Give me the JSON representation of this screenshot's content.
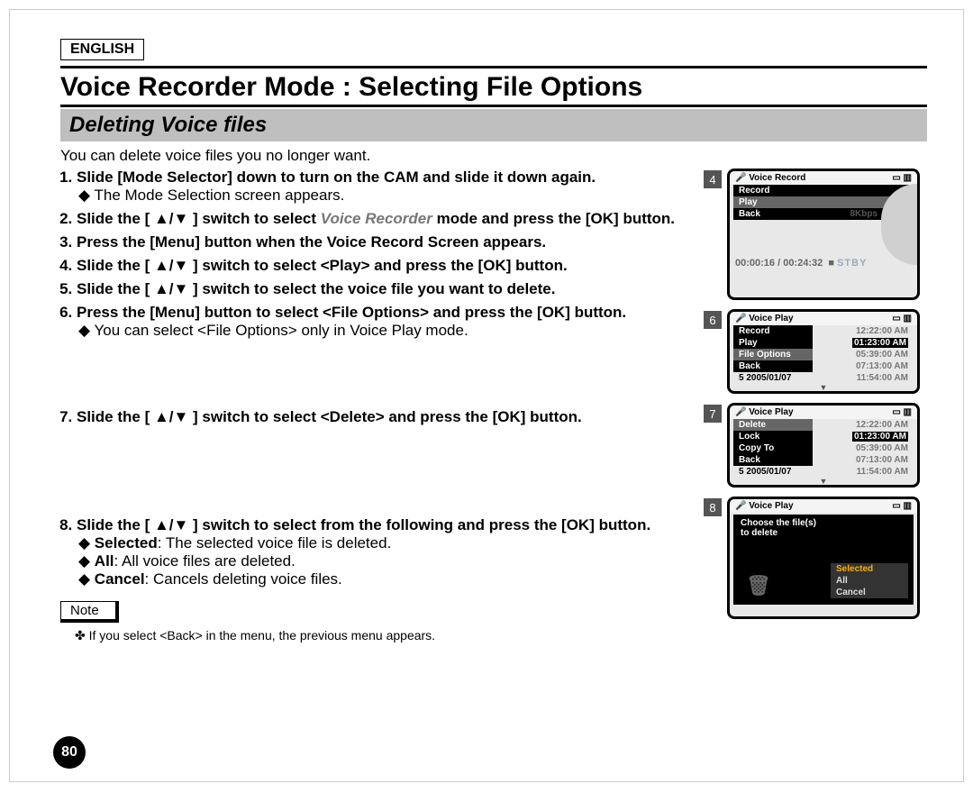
{
  "lang": "ENGLISH",
  "title": "Voice Recorder Mode : Selecting File Options",
  "section": "Deleting Voice files",
  "intro": "You can delete voice files you no longer want.",
  "steps": {
    "s1": "Slide [Mode Selector] down to turn on the CAM and slide it down again.",
    "s1a": "The Mode Selection screen appears.",
    "s2a": "Slide the [ ▲/▼ ] switch to select ",
    "s2grey": "Voice Recorder",
    "s2b": " mode and press the [OK] button.",
    "s3": "Press the [Menu] button when the Voice Record Screen appears.",
    "s4": "Slide the [ ▲/▼ ] switch to select <Play> and press the [OK] button.",
    "s5": "Slide the [ ▲/▼ ] switch to select the voice file you want to delete.",
    "s6": "Press the [Menu] button to select <File Options> and press the [OK] button.",
    "s6a": "You can select <File Options> only in Voice Play mode.",
    "s7": "Slide the [ ▲/▼ ] switch to select <Delete> and press the [OK] button.",
    "s8": "Slide the [ ▲/▼ ] switch to select from the following and press the [OK] button.",
    "s8a_b": "Selected",
    "s8a": ": The selected voice file is deleted.",
    "s8b_b": "All",
    "s8b": ": All voice files are deleted.",
    "s8c_b": "Cancel",
    "s8c": ": Cancels deleting voice files."
  },
  "note_label": "Note",
  "note_text": "If you select <Back> in the menu, the previous menu appears.",
  "page_no": "80",
  "shots": {
    "n4": "4",
    "n6": "6",
    "n7": "7",
    "n8": "8",
    "vr": "Voice Record",
    "vp": "Voice Play",
    "m_record": "Record",
    "m_play": "Play",
    "m_back": "Back",
    "m_fileopt": "File Options",
    "m_delete": "Delete",
    "m_lock": "Lock",
    "m_copyto": "Copy To",
    "bitrate": "8Kbps",
    "timer": "00:00:16 / 00:24:32",
    "stby": "STBY",
    "date": "2005/01/07",
    "row5": "5  2005/01/07",
    "t1": "12:22:00 AM",
    "t2": "01:23:00 AM",
    "t3": "05:39:00 AM",
    "t4": "07:13:00 AM",
    "t5": "11:54:00 AM",
    "choose1": "Choose the file(s)",
    "choose2": "to delete",
    "opt_sel": "Selected",
    "opt_all": "All",
    "opt_cancel": "Cancel",
    "icon_l": "⏺",
    "icon_r": "▭ ▥"
  }
}
